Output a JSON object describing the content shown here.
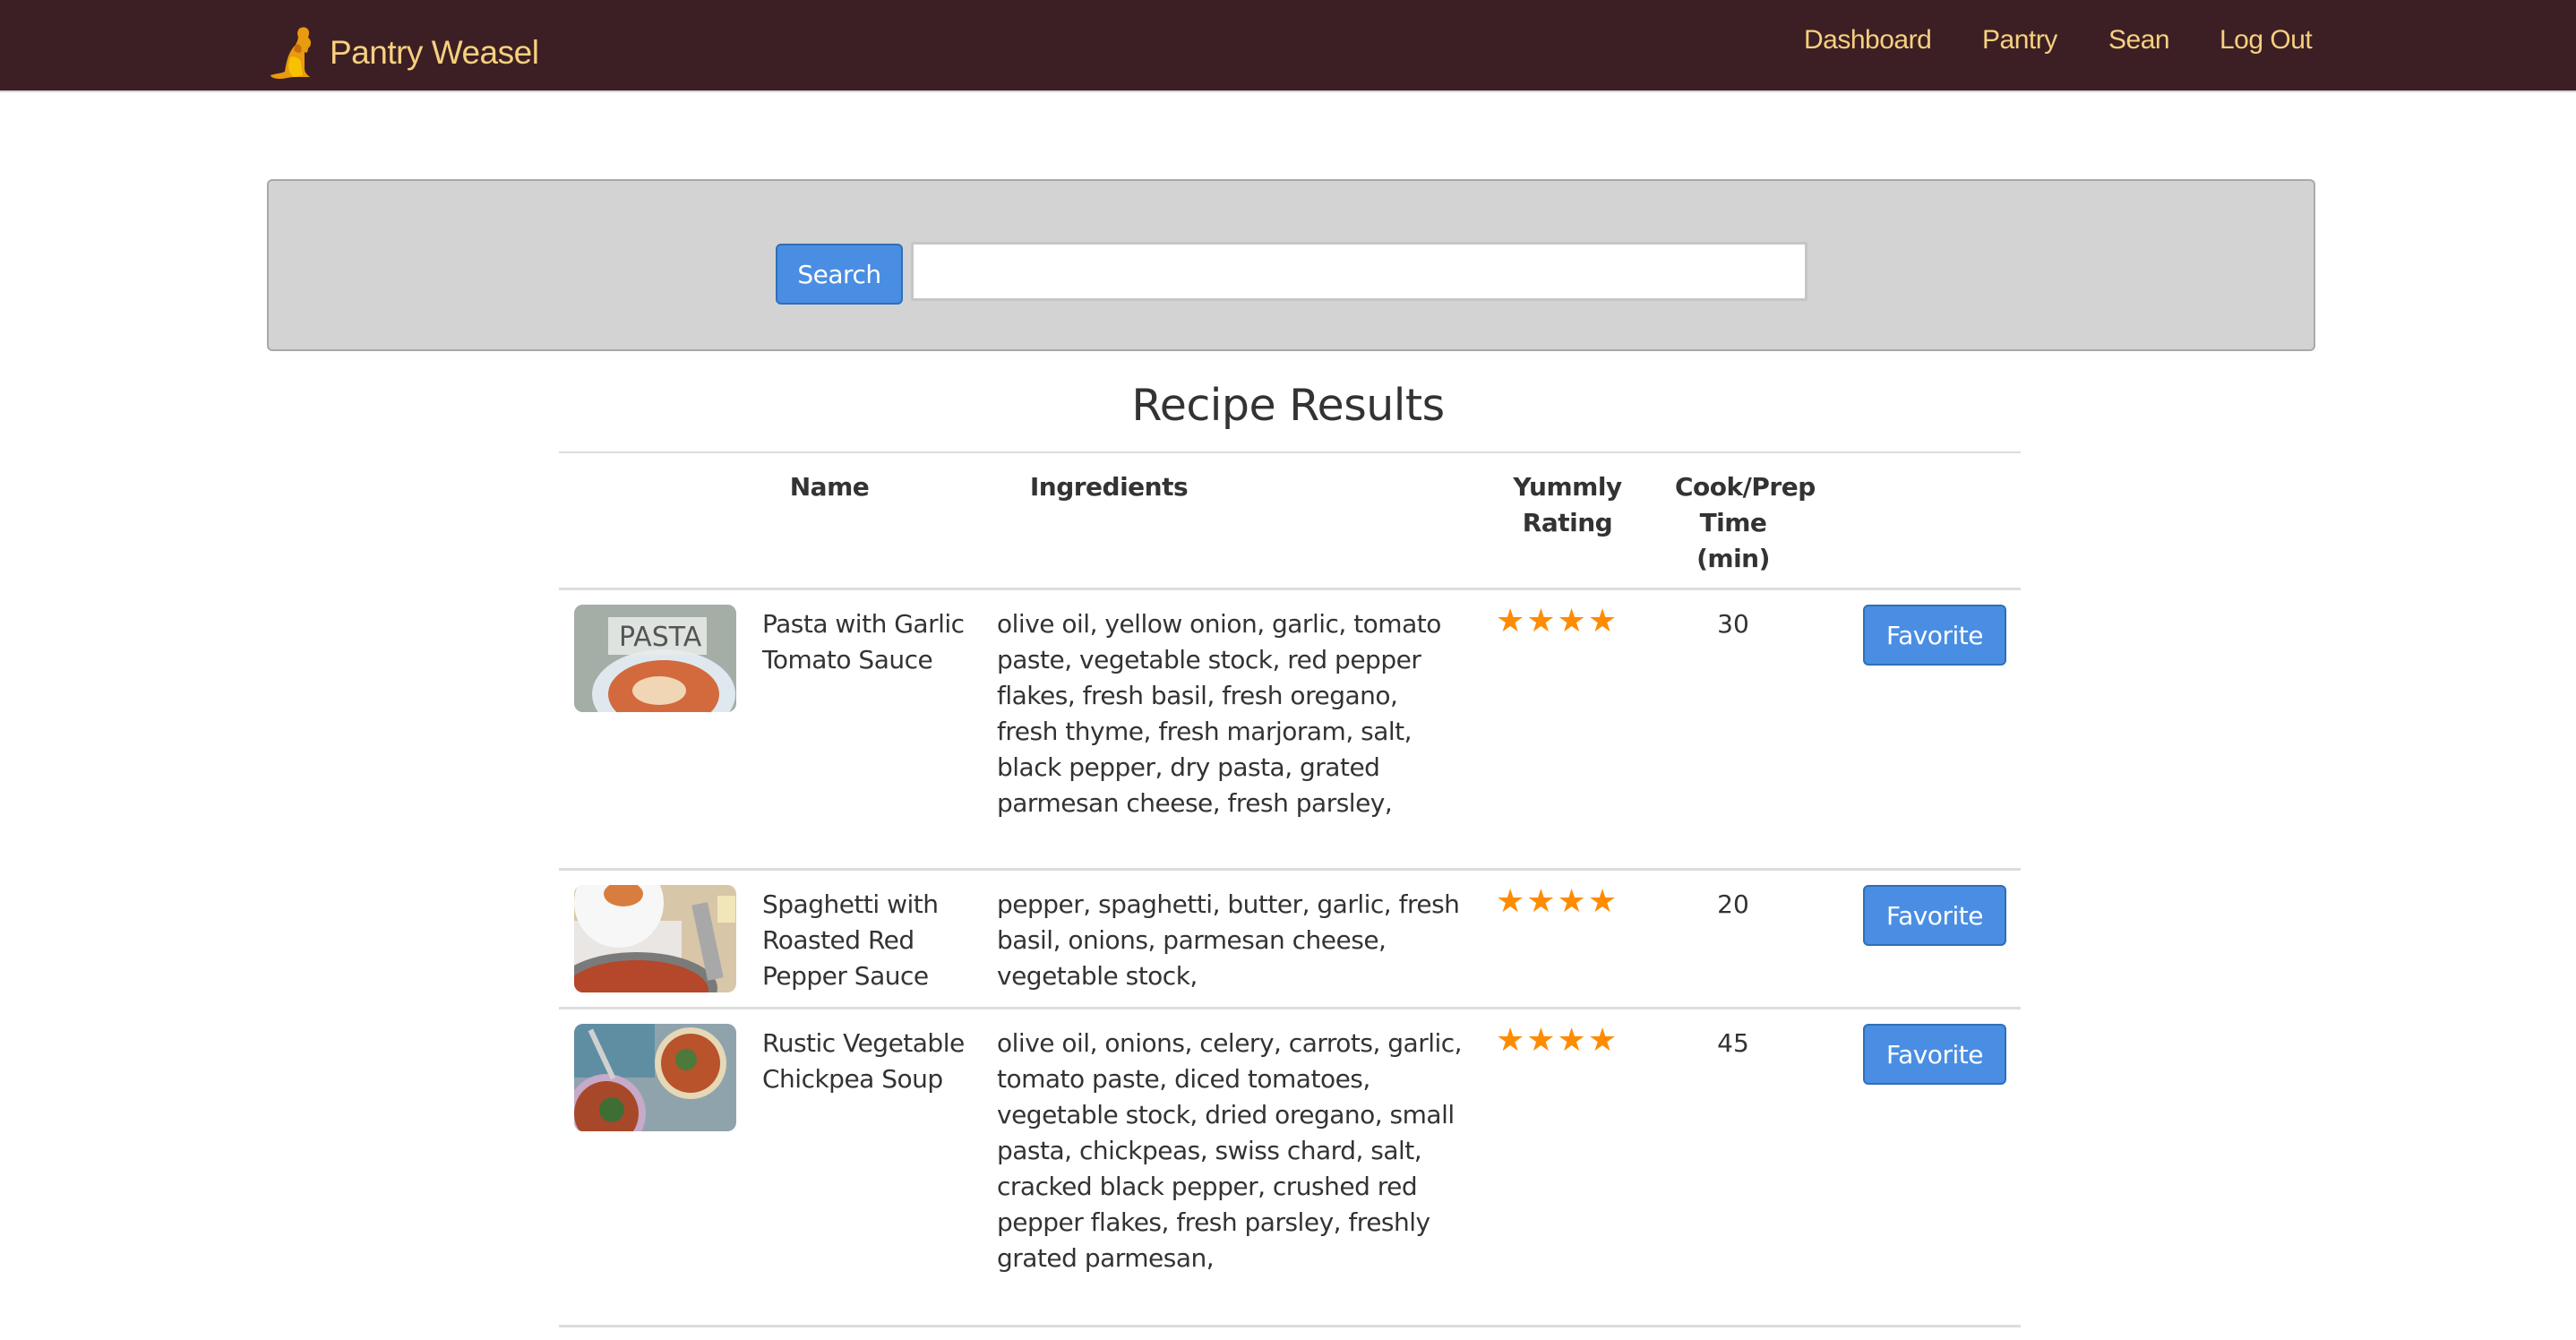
{
  "navbar": {
    "brand": "Pantry Weasel",
    "links": [
      "Dashboard",
      "Pantry",
      "Sean",
      "Log Out"
    ],
    "colors": {
      "background": "#3c1f24",
      "text": "#f6d07f"
    }
  },
  "search": {
    "button_label": "Search",
    "input_value": "",
    "placeholder": ""
  },
  "results": {
    "title": "Recipe Results",
    "columns": {
      "image": "",
      "name": "Name",
      "ingredients": "Ingredients",
      "rating": "Yummly Rating",
      "time": "Cook/Prep Time (min)",
      "action": ""
    },
    "rows": [
      {
        "image": "pasta-photo",
        "name": "Pasta with Garlic Tomato Sauce",
        "ingredients": "olive oil, yellow onion, garlic, tomato paste, vegetable stock, red pepper flakes, fresh basil, fresh oregano, fresh thyme, fresh marjoram, salt, black pepper, dry pasta, grated parmesan cheese, fresh parsley,",
        "rating": 4,
        "stars": "★★★★",
        "time": "30",
        "action_label": "Favorite"
      },
      {
        "image": "spaghetti-photo",
        "name": "Spaghetti with Roasted Red Pepper Sauce",
        "ingredients": "pepper, spaghetti, butter, garlic, fresh basil, onions, parmesan cheese, vegetable stock,",
        "rating": 4,
        "stars": "★★★★",
        "time": "20",
        "action_label": "Favorite"
      },
      {
        "image": "soup-photo",
        "name": "Rustic Vegetable Chickpea Soup",
        "ingredients": "olive oil, onions, celery, carrots, garlic, tomato paste, diced tomatoes, vegetable stock, dried oregano, small pasta, chickpeas, swiss chard, salt, cracked black pepper, crushed red pepper flakes, fresh parsley, freshly grated parmesan,",
        "rating": 4,
        "stars": "★★★★",
        "time": "45",
        "action_label": "Favorite"
      }
    ]
  },
  "colors": {
    "button_blue": "#4a8ee3",
    "star_orange": "#ff8c00",
    "well_gray": "#d3d3d3"
  }
}
